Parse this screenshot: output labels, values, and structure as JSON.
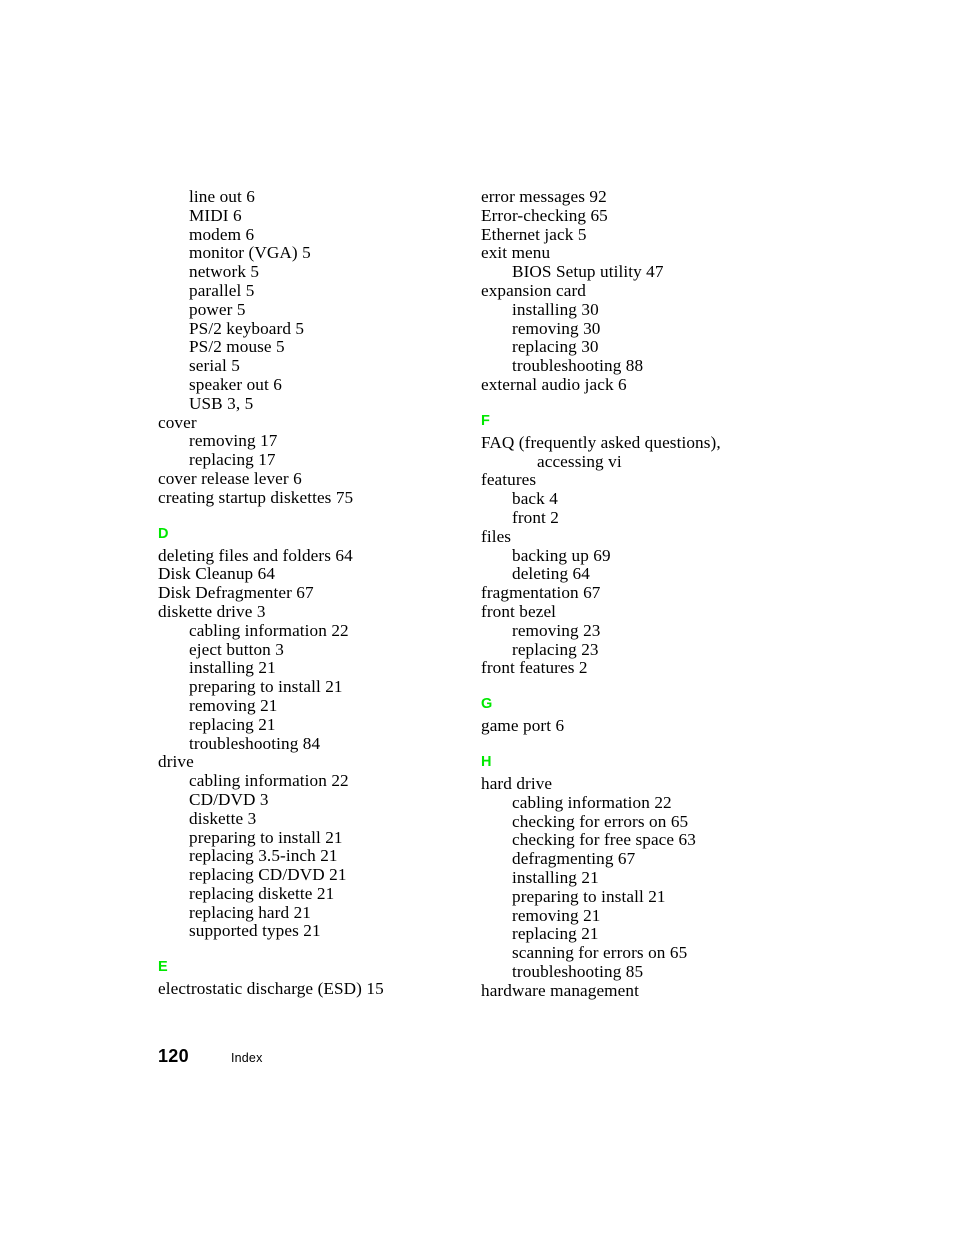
{
  "page": {
    "footer": {
      "page_number": "120",
      "label": "Index"
    }
  },
  "columns": {
    "left": {
      "sections": [
        {
          "heading": null,
          "entries": [
            {
              "level": 2,
              "text": "line out 6"
            },
            {
              "level": 2,
              "text": "MIDI 6"
            },
            {
              "level": 2,
              "text": "modem 6"
            },
            {
              "level": 2,
              "text": "monitor (VGA) 5"
            },
            {
              "level": 2,
              "text": "network 5"
            },
            {
              "level": 2,
              "text": "parallel 5"
            },
            {
              "level": 2,
              "text": "power 5"
            },
            {
              "level": 2,
              "text": "PS/2 keyboard 5"
            },
            {
              "level": 2,
              "text": "PS/2 mouse 5"
            },
            {
              "level": 2,
              "text": "serial 5"
            },
            {
              "level": 2,
              "text": "speaker out 6"
            },
            {
              "level": 2,
              "text": "USB 3, 5"
            },
            {
              "level": 1,
              "text": "cover"
            },
            {
              "level": 2,
              "text": "removing 17"
            },
            {
              "level": 2,
              "text": "replacing 17"
            },
            {
              "level": 1,
              "text": "cover release lever 6"
            },
            {
              "level": 1,
              "text": "creating startup diskettes 75"
            }
          ]
        },
        {
          "heading": "D",
          "entries": [
            {
              "level": 1,
              "text": "deleting files and folders 64"
            },
            {
              "level": 1,
              "text": "Disk Cleanup 64"
            },
            {
              "level": 1,
              "text": "Disk Defragmenter 67"
            },
            {
              "level": 1,
              "text": "diskette drive 3"
            },
            {
              "level": 2,
              "text": "cabling information 22"
            },
            {
              "level": 2,
              "text": "eject button 3"
            },
            {
              "level": 2,
              "text": "installing 21"
            },
            {
              "level": 2,
              "text": "preparing to install 21"
            },
            {
              "level": 2,
              "text": "removing 21"
            },
            {
              "level": 2,
              "text": "replacing 21"
            },
            {
              "level": 2,
              "text": "troubleshooting 84"
            },
            {
              "level": 1,
              "text": "drive"
            },
            {
              "level": 2,
              "text": "cabling information 22"
            },
            {
              "level": 2,
              "text": "CD/DVD 3"
            },
            {
              "level": 2,
              "text": "diskette 3"
            },
            {
              "level": 2,
              "text": "preparing to install 21"
            },
            {
              "level": 2,
              "text": "replacing 3.5-inch 21"
            },
            {
              "level": 2,
              "text": "replacing CD/DVD 21"
            },
            {
              "level": 2,
              "text": "replacing diskette 21"
            },
            {
              "level": 2,
              "text": "replacing hard 21"
            },
            {
              "level": 2,
              "text": "supported types 21"
            }
          ]
        },
        {
          "heading": "E",
          "entries": [
            {
              "level": 1,
              "text": "electrostatic discharge (ESD) 15"
            }
          ]
        }
      ]
    },
    "right": {
      "sections": [
        {
          "heading": null,
          "entries": [
            {
              "level": 1,
              "text": "error messages 92"
            },
            {
              "level": 1,
              "text": "Error-checking 65"
            },
            {
              "level": 1,
              "text": "Ethernet jack 5"
            },
            {
              "level": 1,
              "text": "exit menu"
            },
            {
              "level": 2,
              "text": "BIOS Setup utility 47"
            },
            {
              "level": 1,
              "text": "expansion card"
            },
            {
              "level": 2,
              "text": "installing 30"
            },
            {
              "level": 2,
              "text": "removing 30"
            },
            {
              "level": 2,
              "text": "replacing 30"
            },
            {
              "level": 2,
              "text": "troubleshooting 88"
            },
            {
              "level": 1,
              "text": "external audio jack 6"
            }
          ]
        },
        {
          "heading": "F",
          "entries": [
            {
              "level": 1,
              "text": "FAQ (frequently asked questions),"
            },
            {
              "level": 3,
              "text": "accessing vi"
            },
            {
              "level": 1,
              "text": "features"
            },
            {
              "level": 2,
              "text": "back 4"
            },
            {
              "level": 2,
              "text": "front 2"
            },
            {
              "level": 1,
              "text": "files"
            },
            {
              "level": 2,
              "text": "backing up 69"
            },
            {
              "level": 2,
              "text": "deleting 64"
            },
            {
              "level": 1,
              "text": "fragmentation 67"
            },
            {
              "level": 1,
              "text": "front bezel"
            },
            {
              "level": 2,
              "text": "removing 23"
            },
            {
              "level": 2,
              "text": "replacing 23"
            },
            {
              "level": 1,
              "text": "front features 2"
            }
          ]
        },
        {
          "heading": "G",
          "entries": [
            {
              "level": 1,
              "text": "game port 6"
            }
          ]
        },
        {
          "heading": "H",
          "entries": [
            {
              "level": 1,
              "text": "hard drive"
            },
            {
              "level": 2,
              "text": "cabling information 22"
            },
            {
              "level": 2,
              "text": "checking for errors on 65"
            },
            {
              "level": 2,
              "text": "checking for free space 63"
            },
            {
              "level": 2,
              "text": "defragmenting 67"
            },
            {
              "level": 2,
              "text": "installing 21"
            },
            {
              "level": 2,
              "text": "preparing to install 21"
            },
            {
              "level": 2,
              "text": "removing 21"
            },
            {
              "level": 2,
              "text": "replacing 21"
            },
            {
              "level": 2,
              "text": "scanning for errors on 65"
            },
            {
              "level": 2,
              "text": "troubleshooting 85"
            },
            {
              "level": 1,
              "text": "hardware management"
            }
          ]
        }
      ]
    }
  },
  "colors": {
    "section_heading": "#00e800",
    "text": "#000000",
    "background": "#ffffff"
  }
}
